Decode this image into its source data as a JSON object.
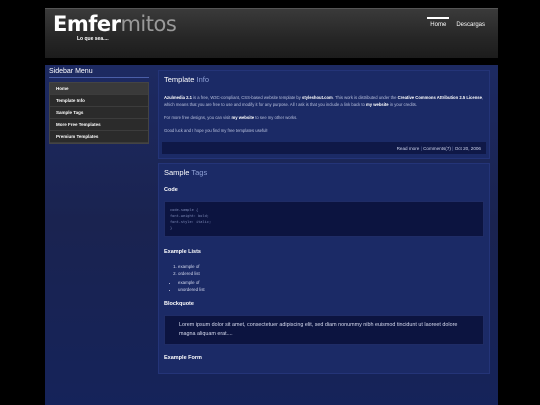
{
  "header": {
    "logo_bold": "Emfer",
    "logo_light": "mitos",
    "tagline": "Lo que sea....",
    "nav": [
      "Home",
      "Descargas"
    ]
  },
  "sidebar": {
    "title": "Sidebar Menu",
    "items": [
      "Home",
      "Template Info",
      "Sample Tags",
      "More Free Templates",
      "Premium Templates"
    ]
  },
  "post": {
    "title_bold": "Template",
    "title_light": "Info",
    "p1_name": "Azulmedia 2.1",
    "p1_text1": " is a free, W3C-compliant, CSS-based website template by ",
    "p1_author": "styleshout.com",
    "p1_text2": ". This work is distributed under the ",
    "p1_license": "Creative Commons Attribution 2.5 License",
    "p1_text3": ", which means that you are free to use and modify it for any purpose. All I ask is that you include a link back to ",
    "p1_link": "my website",
    "p1_text4": " in your credits.",
    "p2_text1": "For more free designs, you can visit ",
    "p2_link": "my website",
    "p2_text2": " to see my other works.",
    "p3": "Good luck and I hope you find my free templates useful!",
    "meta_read": "Read more",
    "meta_comments": "Comments(7)",
    "meta_date": "Oct 20, 2006"
  },
  "tags": {
    "title_bold": "Sample",
    "title_light": "Tags",
    "code_heading": "Code",
    "code_lines": [
      "code-sample {",
      "font-weight: bold;",
      "font-style: italic;",
      "}"
    ],
    "lists_heading": "Example Lists",
    "ordered": [
      "example of",
      "ordered list"
    ],
    "unordered": [
      "example of",
      "unordered list"
    ],
    "quote_heading": "Blockquote",
    "quote": "Lorem ipsum dolor sit amet, consectetuer adipiscing elit, sed diam nonummy nibh euismod tincidunt ut laoreet dolore magna aliquam erat....",
    "form_heading": "Example Form"
  }
}
